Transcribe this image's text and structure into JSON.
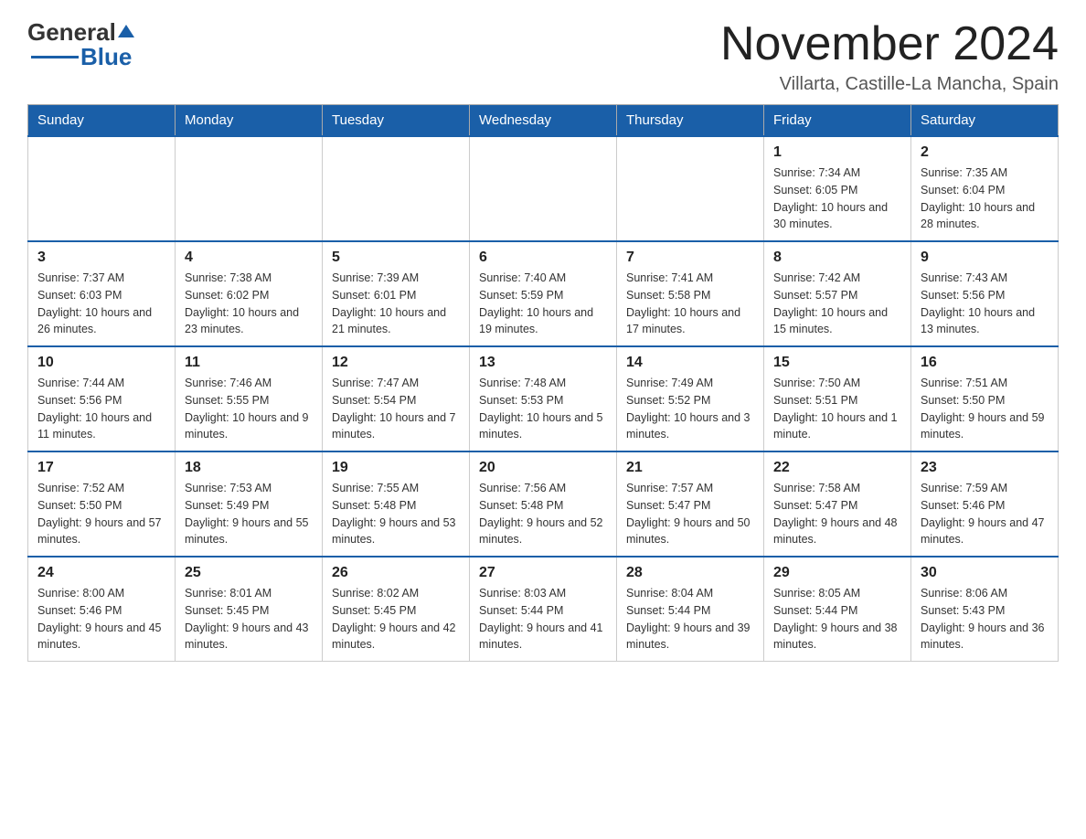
{
  "header": {
    "logo_general": "General",
    "logo_blue": "Blue",
    "main_title": "November 2024",
    "subtitle": "Villarta, Castille-La Mancha, Spain"
  },
  "days_of_week": [
    "Sunday",
    "Monday",
    "Tuesday",
    "Wednesday",
    "Thursday",
    "Friday",
    "Saturday"
  ],
  "weeks": [
    [
      {
        "day": "",
        "info": ""
      },
      {
        "day": "",
        "info": ""
      },
      {
        "day": "",
        "info": ""
      },
      {
        "day": "",
        "info": ""
      },
      {
        "day": "",
        "info": ""
      },
      {
        "day": "1",
        "info": "Sunrise: 7:34 AM\nSunset: 6:05 PM\nDaylight: 10 hours and 30 minutes."
      },
      {
        "day": "2",
        "info": "Sunrise: 7:35 AM\nSunset: 6:04 PM\nDaylight: 10 hours and 28 minutes."
      }
    ],
    [
      {
        "day": "3",
        "info": "Sunrise: 7:37 AM\nSunset: 6:03 PM\nDaylight: 10 hours and 26 minutes."
      },
      {
        "day": "4",
        "info": "Sunrise: 7:38 AM\nSunset: 6:02 PM\nDaylight: 10 hours and 23 minutes."
      },
      {
        "day": "5",
        "info": "Sunrise: 7:39 AM\nSunset: 6:01 PM\nDaylight: 10 hours and 21 minutes."
      },
      {
        "day": "6",
        "info": "Sunrise: 7:40 AM\nSunset: 5:59 PM\nDaylight: 10 hours and 19 minutes."
      },
      {
        "day": "7",
        "info": "Sunrise: 7:41 AM\nSunset: 5:58 PM\nDaylight: 10 hours and 17 minutes."
      },
      {
        "day": "8",
        "info": "Sunrise: 7:42 AM\nSunset: 5:57 PM\nDaylight: 10 hours and 15 minutes."
      },
      {
        "day": "9",
        "info": "Sunrise: 7:43 AM\nSunset: 5:56 PM\nDaylight: 10 hours and 13 minutes."
      }
    ],
    [
      {
        "day": "10",
        "info": "Sunrise: 7:44 AM\nSunset: 5:56 PM\nDaylight: 10 hours and 11 minutes."
      },
      {
        "day": "11",
        "info": "Sunrise: 7:46 AM\nSunset: 5:55 PM\nDaylight: 10 hours and 9 minutes."
      },
      {
        "day": "12",
        "info": "Sunrise: 7:47 AM\nSunset: 5:54 PM\nDaylight: 10 hours and 7 minutes."
      },
      {
        "day": "13",
        "info": "Sunrise: 7:48 AM\nSunset: 5:53 PM\nDaylight: 10 hours and 5 minutes."
      },
      {
        "day": "14",
        "info": "Sunrise: 7:49 AM\nSunset: 5:52 PM\nDaylight: 10 hours and 3 minutes."
      },
      {
        "day": "15",
        "info": "Sunrise: 7:50 AM\nSunset: 5:51 PM\nDaylight: 10 hours and 1 minute."
      },
      {
        "day": "16",
        "info": "Sunrise: 7:51 AM\nSunset: 5:50 PM\nDaylight: 9 hours and 59 minutes."
      }
    ],
    [
      {
        "day": "17",
        "info": "Sunrise: 7:52 AM\nSunset: 5:50 PM\nDaylight: 9 hours and 57 minutes."
      },
      {
        "day": "18",
        "info": "Sunrise: 7:53 AM\nSunset: 5:49 PM\nDaylight: 9 hours and 55 minutes."
      },
      {
        "day": "19",
        "info": "Sunrise: 7:55 AM\nSunset: 5:48 PM\nDaylight: 9 hours and 53 minutes."
      },
      {
        "day": "20",
        "info": "Sunrise: 7:56 AM\nSunset: 5:48 PM\nDaylight: 9 hours and 52 minutes."
      },
      {
        "day": "21",
        "info": "Sunrise: 7:57 AM\nSunset: 5:47 PM\nDaylight: 9 hours and 50 minutes."
      },
      {
        "day": "22",
        "info": "Sunrise: 7:58 AM\nSunset: 5:47 PM\nDaylight: 9 hours and 48 minutes."
      },
      {
        "day": "23",
        "info": "Sunrise: 7:59 AM\nSunset: 5:46 PM\nDaylight: 9 hours and 47 minutes."
      }
    ],
    [
      {
        "day": "24",
        "info": "Sunrise: 8:00 AM\nSunset: 5:46 PM\nDaylight: 9 hours and 45 minutes."
      },
      {
        "day": "25",
        "info": "Sunrise: 8:01 AM\nSunset: 5:45 PM\nDaylight: 9 hours and 43 minutes."
      },
      {
        "day": "26",
        "info": "Sunrise: 8:02 AM\nSunset: 5:45 PM\nDaylight: 9 hours and 42 minutes."
      },
      {
        "day": "27",
        "info": "Sunrise: 8:03 AM\nSunset: 5:44 PM\nDaylight: 9 hours and 41 minutes."
      },
      {
        "day": "28",
        "info": "Sunrise: 8:04 AM\nSunset: 5:44 PM\nDaylight: 9 hours and 39 minutes."
      },
      {
        "day": "29",
        "info": "Sunrise: 8:05 AM\nSunset: 5:44 PM\nDaylight: 9 hours and 38 minutes."
      },
      {
        "day": "30",
        "info": "Sunrise: 8:06 AM\nSunset: 5:43 PM\nDaylight: 9 hours and 36 minutes."
      }
    ]
  ]
}
